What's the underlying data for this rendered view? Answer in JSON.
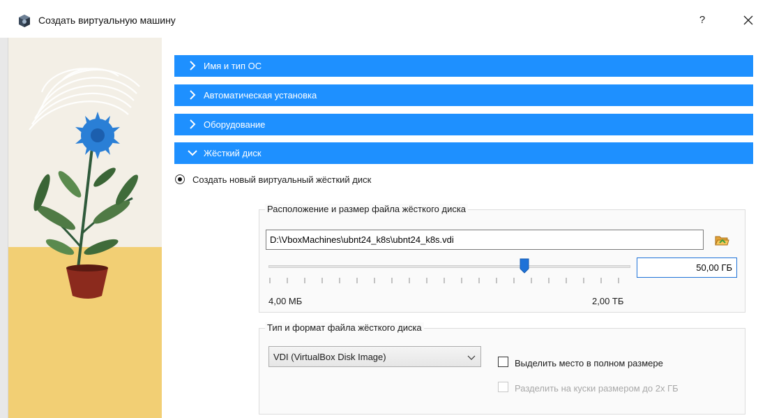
{
  "window": {
    "title": "Создать виртуальную машину",
    "help_label": "?",
    "icon": "virtualbox-icon"
  },
  "sections": [
    {
      "label": "Имя и тип ОС",
      "expanded": false
    },
    {
      "label": "Автоматическая установка",
      "expanded": false
    },
    {
      "label": "Оборудование",
      "expanded": false
    },
    {
      "label": "Жёсткий диск",
      "expanded": true
    }
  ],
  "disk": {
    "create_new_label": "Создать новый виртуальный жёсткий диск",
    "create_new_selected": true,
    "location_group_title": "Расположение и размер файла жёсткого диска",
    "file_path": "D:\\VboxMachines\\ubnt24_k8s\\ubnt24_k8s.vdi",
    "size_value": "50,00 ГБ",
    "slider_min_label": "4,00 МБ",
    "slider_max_label": "2,00 ТБ",
    "format_group_title": "Тип и формат файла жёсткого диска",
    "format_selected": "VDI (VirtualBox Disk Image)",
    "preallocate_label": "Выделить место в полном размере",
    "preallocate_checked": false,
    "split_label": "Разделить на куски размером до 2х ГБ",
    "split_checked": false,
    "split_enabled": false
  },
  "colors": {
    "section_bar": "#1e90ff",
    "accent": "#1e72d8"
  }
}
